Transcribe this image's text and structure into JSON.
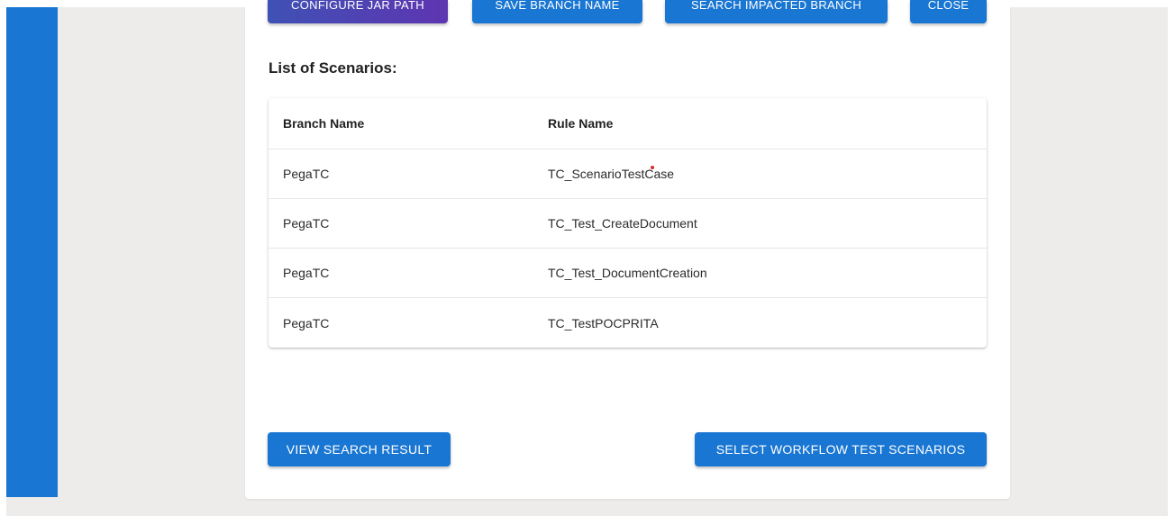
{
  "toolbar": {
    "configure_jar_path": "CONFIGURE JAR PATH",
    "save_branch_name": "SAVE BRANCH NAME",
    "search_impacted_branch": "SEARCH IMPACTED BRANCH",
    "close": "CLOSE"
  },
  "section_title": "List of Scenarios:",
  "table": {
    "columns": [
      "Branch Name",
      "Rule Name"
    ],
    "rows": [
      [
        "PegaTC",
        "TC_ScenarioTestCase"
      ],
      [
        "PegaTC",
        "TC_Test_CreateDocument"
      ],
      [
        "PegaTC",
        "TC_Test_DocumentCreation"
      ],
      [
        "PegaTC",
        "TC_TestPOCPRITA"
      ]
    ]
  },
  "actions": {
    "view_search_result": "VIEW SEARCH RESULT",
    "select_workflow_test_scenarios": "SELECT WORKFLOW TEST SCENARIOS"
  },
  "colors": {
    "primary": "#1976d2",
    "accent_gradient_start": "#3f51b5",
    "accent_gradient_end": "#5e35b1",
    "page_background": "#edecea"
  }
}
